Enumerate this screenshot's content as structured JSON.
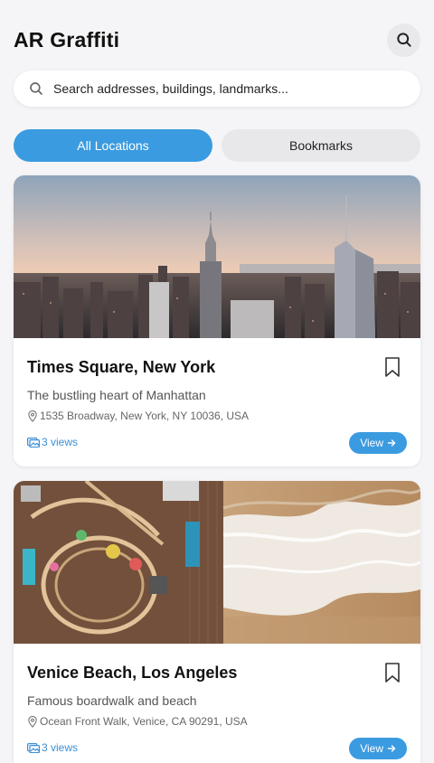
{
  "app": {
    "title": "AR Graffiti"
  },
  "search": {
    "placeholder": "Search addresses, buildings, landmarks..."
  },
  "tabs": [
    {
      "label": "All Locations",
      "active": true
    },
    {
      "label": "Bookmarks",
      "active": false
    }
  ],
  "locations": [
    {
      "title": "Times Square, New York",
      "description": "The bustling heart of Manhattan",
      "address": "1535 Broadway, New York, NY 10036, USA",
      "views": "3 views",
      "view_label": "View",
      "image": "new-york-skyline-photo"
    },
    {
      "title": "Venice Beach, Los Angeles",
      "description": "Famous boardwalk and beach",
      "address": "Ocean Front Walk, Venice, CA 90291, USA",
      "views": "3 views",
      "view_label": "View",
      "image": "venice-pier-beach-aerial-photo"
    }
  ],
  "colors": {
    "accent": "#3b9be0",
    "background": "#f5f5f7",
    "views_text": "#3b8fd6"
  },
  "icons": [
    "search-icon",
    "bookmark-icon",
    "map-pin-icon",
    "image-icon",
    "arrow-right-icon"
  ]
}
